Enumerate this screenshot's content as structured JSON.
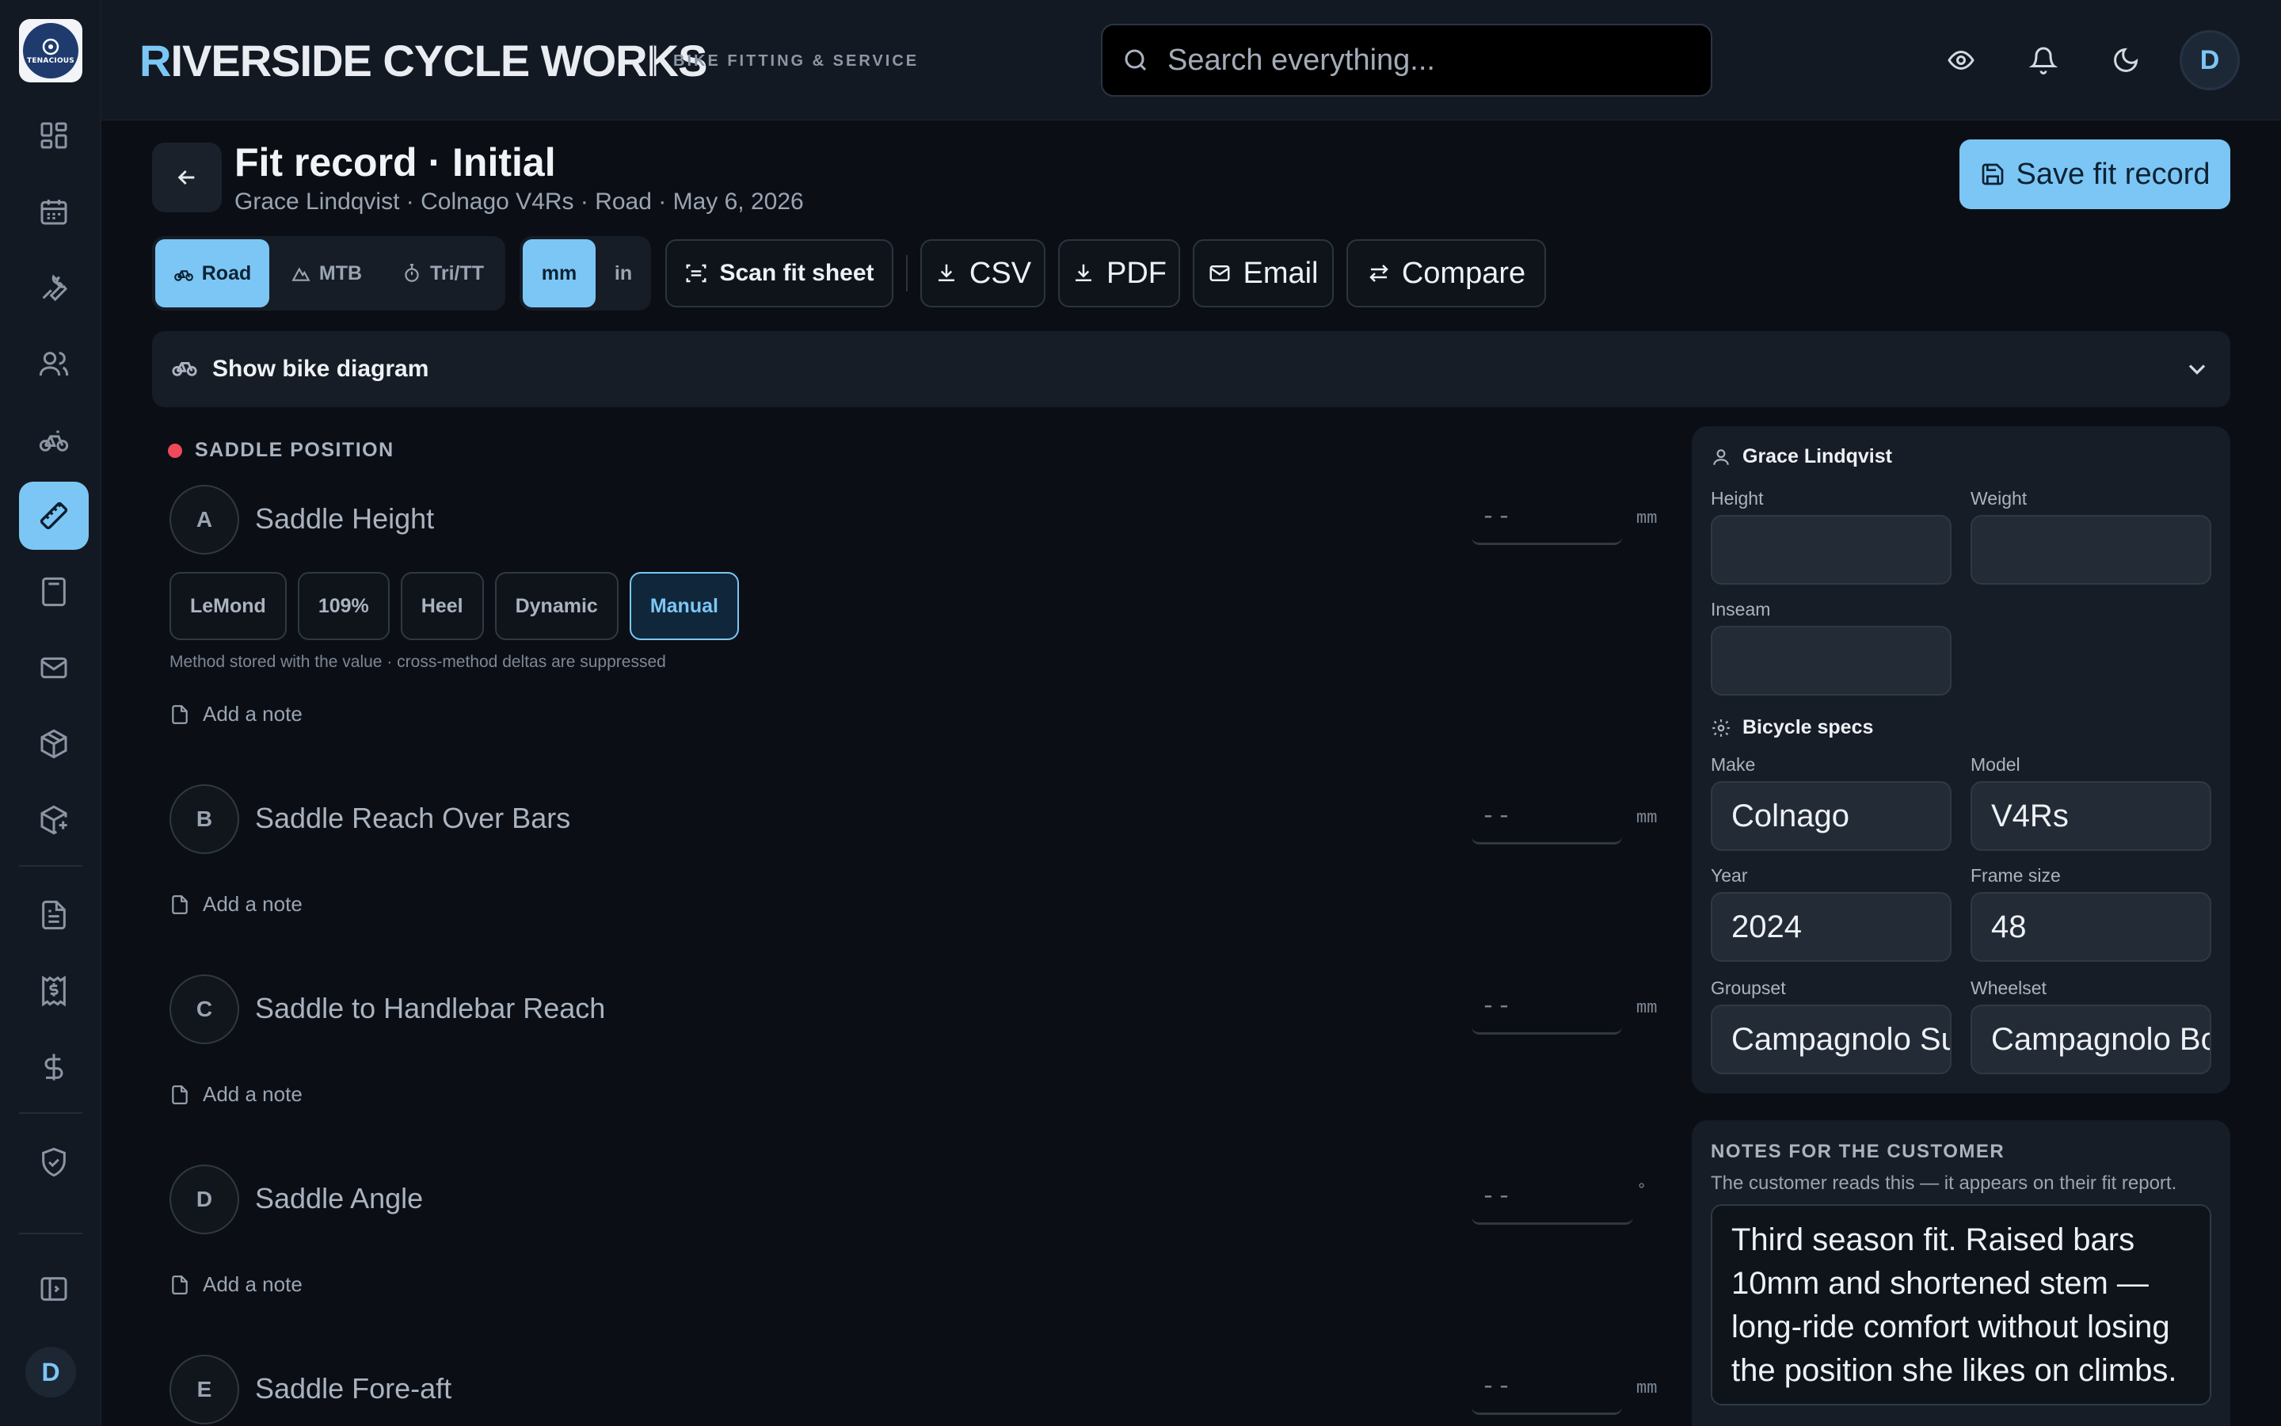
{
  "brand": {
    "logo_text": "TENACIOUS",
    "name_first": "R",
    "name_rest": "IVERSIDE CYCLE WORKS",
    "subtitle": "BIKE FITTING & SERVICE"
  },
  "search": {
    "placeholder": "Search everything..."
  },
  "user": {
    "initial": "D"
  },
  "page": {
    "title": "Fit record · Initial",
    "subtitle": "Grace Lindqvist · Colnago V4Rs · Road · May 6, 2026",
    "save_label": "Save fit record"
  },
  "toolbar": {
    "disciplines": [
      "Road",
      "MTB",
      "Tri/TT"
    ],
    "units": [
      "mm",
      "in"
    ],
    "scan_label": "Scan fit sheet",
    "csv_label": "CSV",
    "pdf_label": "PDF",
    "email_label": "Email",
    "compare_label": "Compare"
  },
  "diagram": {
    "label": "Show bike diagram"
  },
  "section": {
    "title": "SADDLE POSITION"
  },
  "measurements": [
    {
      "letter": "A",
      "label": "Saddle Height",
      "placeholder": "--",
      "unit": "mm"
    },
    {
      "letter": "B",
      "label": "Saddle Reach Over Bars",
      "placeholder": "--",
      "unit": "mm"
    },
    {
      "letter": "C",
      "label": "Saddle to Handlebar Reach",
      "placeholder": "--",
      "unit": "mm"
    },
    {
      "letter": "D",
      "label": "Saddle Angle",
      "placeholder": "--",
      "unit": "°"
    },
    {
      "letter": "E",
      "label": "Saddle Fore-aft",
      "placeholder": "--",
      "unit": "mm"
    }
  ],
  "methods": [
    "LeMond",
    "109%",
    "Heel",
    "Dynamic",
    "Manual"
  ],
  "method_selected": "Manual",
  "method_note": "Method stored with the value · cross-method deltas are suppressed",
  "add_note_label": "Add a note",
  "customer": {
    "name": "Grace Lindqvist",
    "height_label": "Height",
    "weight_label": "Weight",
    "inseam_label": "Inseam",
    "height": "",
    "weight": "",
    "inseam": ""
  },
  "bicycle": {
    "title": "Bicycle specs",
    "make_label": "Make",
    "make": "Colnago",
    "model_label": "Model",
    "model": "V4Rs",
    "year_label": "Year",
    "year": "2024",
    "frame_label": "Frame size",
    "frame": "48",
    "groupset_label": "Groupset",
    "groupset": "Campagnolo Super Record",
    "wheelset_label": "Wheelset",
    "wheelset": "Campagnolo Bora"
  },
  "notes": {
    "title": "NOTES FOR THE CUSTOMER",
    "description": "The customer reads this — it appears on their fit report.",
    "text": "Third season fit. Raised bars 10mm and shortened stem — long-ride comfort without losing the position she likes on climbs."
  },
  "colors": {
    "accent": "#7cc6f5",
    "background": "#0b0f15",
    "panel": "#161d26",
    "alert": "#ef4a5a"
  }
}
